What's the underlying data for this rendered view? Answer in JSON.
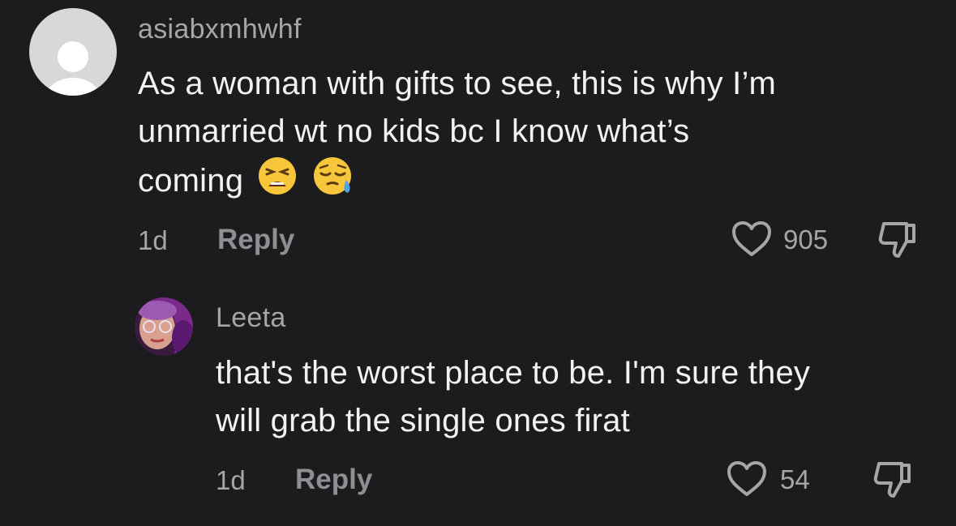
{
  "comment": {
    "username": "asiabxmhwhf",
    "text_lines": [
      "As a woman with gifts to see, this is why I’m",
      "unmarried wt no kids bc I know what’s",
      "coming"
    ],
    "emojis": [
      "tired-face-emoji",
      "sleepy-face-emoji"
    ],
    "time": "1d",
    "reply_label": "Reply",
    "likes": "905",
    "icons": {
      "like": "heart-outline-icon",
      "dislike": "thumbs-down-outline-icon"
    }
  },
  "reply": {
    "username": "Leeta",
    "text_lines": [
      "that's the worst place to be. I'm sure they",
      "will grab the single ones firat"
    ],
    "time": "1d",
    "reply_label": "Reply",
    "likes": "54",
    "icons": {
      "like": "heart-outline-icon",
      "dislike": "thumbs-down-outline-icon"
    }
  },
  "colors": {
    "background": "#1c1c1e",
    "primary_text": "#f2f2f2",
    "secondary_text": "#a6a6a6",
    "reply_text": "#8e8e93"
  }
}
